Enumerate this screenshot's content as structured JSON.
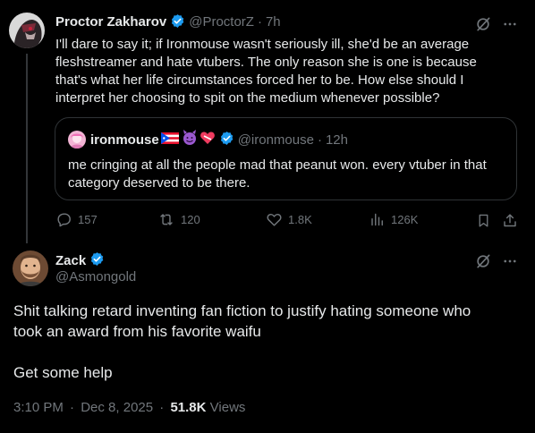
{
  "tweet1": {
    "name": "Proctor Zakharov",
    "handle": "@ProctorZ",
    "sep": "·",
    "time": "7h",
    "lines": [
      "I'll dare to say it; if Ironmouse wasn't seriously ill, she'd be an average",
      "fleshstreamer and hate vtubers. The only reason she is one is because",
      "that's what her life circumstances forced her to be. How else should I",
      "interpret her choosing to spit on the medium whenever possible?"
    ],
    "quote": {
      "name": "ironmouse",
      "handle": "@ironmouse",
      "sep": "·",
      "time": "12h",
      "lines": [
        "me cringing at all the people mad that peanut won. every vtuber in that",
        "category deserved to be there."
      ]
    },
    "actions": {
      "replies": "157",
      "reposts": "120",
      "likes": "1.8K",
      "views": "126K"
    }
  },
  "tweet2": {
    "name": "Zack",
    "handle": "@Asmongold",
    "lines": [
      "Shit talking retard inventing fan fiction to justify hating someone who",
      "took an award from his favorite waifu"
    ],
    "line_extra": "Get some help",
    "time": "3:10 PM",
    "sep": "·",
    "date": "Dec 8, 2025",
    "sep2": "·",
    "views_count": "51.8K",
    "views_label": "Views"
  },
  "colors": {
    "background": "#000000",
    "text": "#e7e9ea",
    "muted": "#71767b",
    "verified": "#1d9bf0",
    "border": "#2f3336"
  }
}
